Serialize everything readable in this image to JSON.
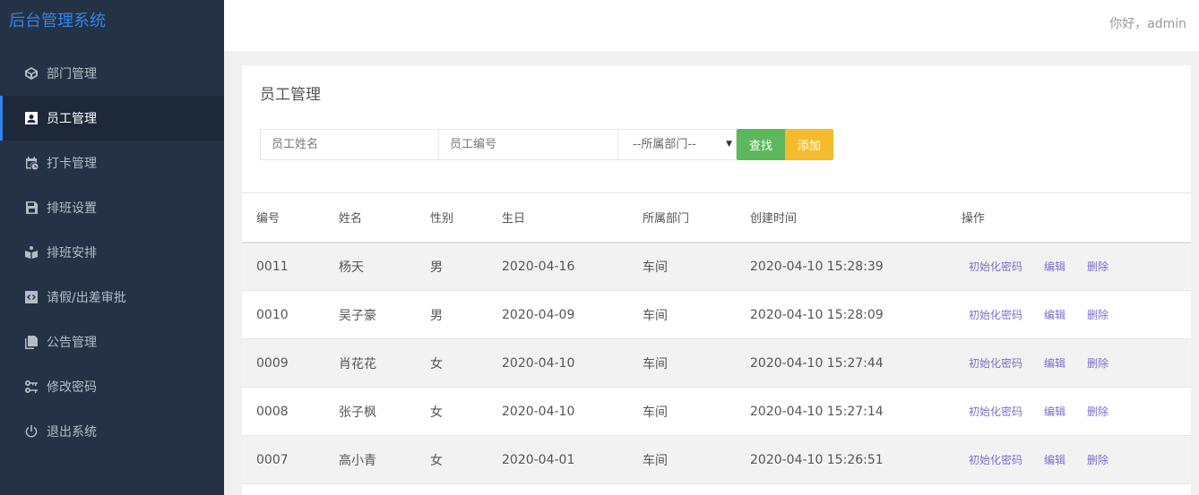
{
  "sidebar": {
    "brand": "后台管理系统",
    "items": [
      {
        "label": "部门管理",
        "icon": "cube-icon"
      },
      {
        "label": "员工管理",
        "icon": "user-card-icon",
        "active": true
      },
      {
        "label": "打卡管理",
        "icon": "calendar-clock-icon"
      },
      {
        "label": "排班设置",
        "icon": "floppy-icon"
      },
      {
        "label": "排班安排",
        "icon": "box-icon"
      },
      {
        "label": "请假/出差审批",
        "icon": "code-icon"
      },
      {
        "label": "公告管理",
        "icon": "documents-icon"
      },
      {
        "label": "修改密码",
        "icon": "key-icon"
      },
      {
        "label": "退出系统",
        "icon": "power-icon"
      }
    ]
  },
  "header": {
    "greeting": "你好，admin"
  },
  "main": {
    "title": "员工管理",
    "filters": {
      "name_placeholder": "员工姓名",
      "number_placeholder": "员工编号",
      "department_selected": "--所属部门--",
      "search_label": "查找",
      "add_label": "添加"
    },
    "table": {
      "columns": [
        "编号",
        "姓名",
        "性别",
        "生日",
        "所属部门",
        "创建时间",
        "操作"
      ],
      "rows": [
        {
          "id": "0011",
          "name": "杨天",
          "gender": "男",
          "birthday": "2020-04-16",
          "dept": "车间",
          "created": "2020-04-10 15:28:39"
        },
        {
          "id": "0010",
          "name": "吴子豪",
          "gender": "男",
          "birthday": "2020-04-09",
          "dept": "车间",
          "created": "2020-04-10 15:28:09"
        },
        {
          "id": "0009",
          "name": "肖花花",
          "gender": "女",
          "birthday": "2020-04-10",
          "dept": "车间",
          "created": "2020-04-10 15:27:44"
        },
        {
          "id": "0008",
          "name": "张子枫",
          "gender": "女",
          "birthday": "2020-04-10",
          "dept": "车间",
          "created": "2020-04-10 15:27:14"
        },
        {
          "id": "0007",
          "name": "高小青",
          "gender": "女",
          "birthday": "2020-04-01",
          "dept": "车间",
          "created": "2020-04-10 15:26:51"
        }
      ],
      "actions": {
        "reset_password": "初始化密码",
        "edit": "编辑",
        "delete": "删除"
      }
    }
  },
  "colors": {
    "sidebar_bg": "#253245",
    "accent": "#2f84f0",
    "search_button": "#5cb85c",
    "add_button": "#f4bb2c",
    "action_link": "#7a6fc9"
  }
}
